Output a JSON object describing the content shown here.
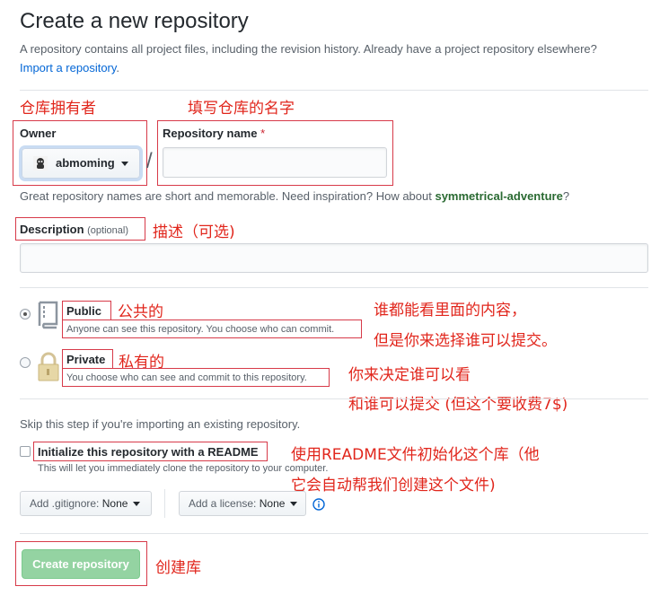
{
  "header": {
    "title": "Create a new repository",
    "subtitle": "A repository contains all project files, including the revision history. Already have a project repository elsewhere?",
    "import_link": "Import a repository",
    "import_suffix": "."
  },
  "annotations": {
    "owner": "仓库拥有者",
    "repo_name": "填写仓库的名字",
    "description": "描述（可选)",
    "public": "公共的",
    "public_detail_1": "谁都能看里面的内容，",
    "public_detail_2": "但是你来选择谁可以提交。",
    "private": "私有的",
    "private_detail_1": "你来决定谁可以看",
    "private_detail_2": "和谁可以提交 (但这个要收费7$)",
    "readme_1": "使用README文件初始化这个库（他",
    "readme_2": "它会自动帮我们创建这个文件)",
    "create": "创建库"
  },
  "owner": {
    "label": "Owner",
    "value": "abmoming",
    "separator": "/"
  },
  "repository_name": {
    "label": "Repository name",
    "required_mark": "*",
    "value": "",
    "placeholder": ""
  },
  "name_help": {
    "prefix": "Great repository names are short and memorable. Need inspiration? How about ",
    "suggestion": "symmetrical-adventure",
    "suffix": "?"
  },
  "description": {
    "label": "Description",
    "optional": "(optional)",
    "value": "",
    "placeholder": ""
  },
  "visibility": {
    "selected": "public",
    "public_label": "Public",
    "public_desc": "Anyone can see this repository. You choose who can commit.",
    "private_label": "Private",
    "private_desc": "You choose who can see and commit to this repository."
  },
  "init": {
    "skip_text": "Skip this step if you're importing an existing repository.",
    "readme_label": "Initialize this repository with a README",
    "readme_checked": false,
    "readme_desc": "This will let you immediately clone the repository to your computer.",
    "gitignore_prefix": "Add .gitignore:",
    "gitignore_value": "None",
    "license_prefix": "Add a license:",
    "license_value": "None"
  },
  "actions": {
    "create_label": "Create repository"
  },
  "colors": {
    "annotation_red": "#e1261c",
    "create_button_green": "#94d3a2",
    "link_blue": "#0366d6"
  }
}
